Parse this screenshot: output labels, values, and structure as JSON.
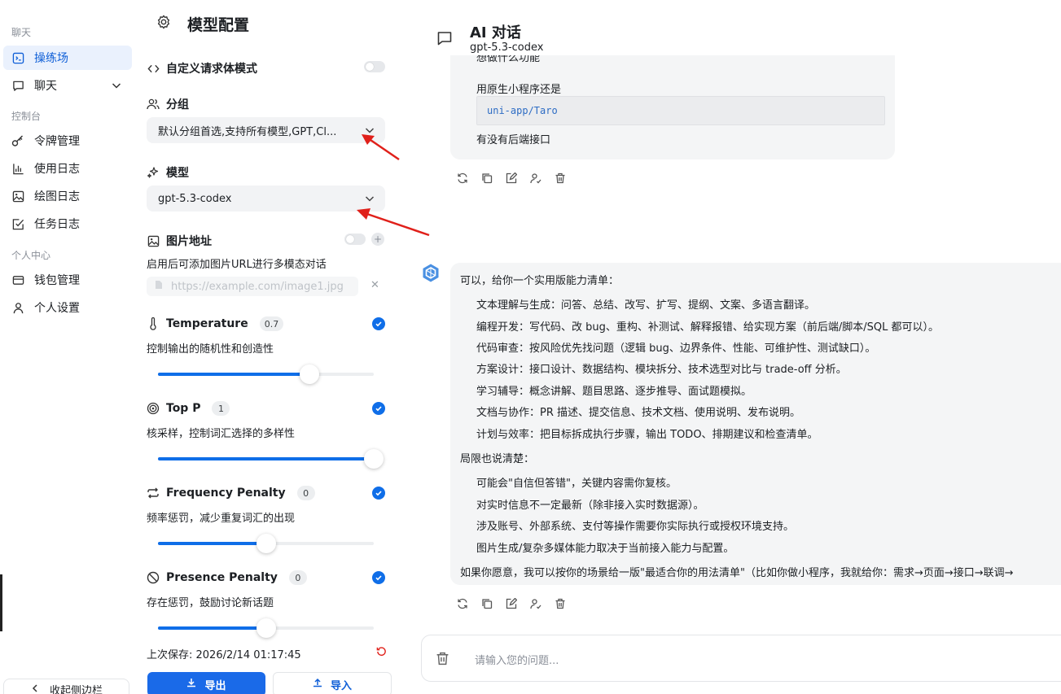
{
  "nav": {
    "section_chat": "聊天",
    "playground": "操练场",
    "chat": "聊天",
    "section_console": "控制台",
    "tokens": "令牌管理",
    "usage_logs": "使用日志",
    "draw_logs": "绘图日志",
    "task_logs": "任务日志",
    "section_personal": "个人中心",
    "wallet": "钱包管理",
    "settings": "个人设置",
    "collapse": "收起侧边栏"
  },
  "panel": {
    "title": "模型配置",
    "custom_body": "自定义请求体模式",
    "group_label": "分组",
    "group_value": "默认分组首选,支持所有模型,GPT,Cl...",
    "model_label": "模型",
    "model_value": "gpt-5.3-codex",
    "image_label": "图片地址",
    "image_desc": "启用后可添加图片URL进行多模态对话",
    "image_placeholder": "https://example.com/image1.jpg",
    "temperature": {
      "label": "Temperature",
      "value": "0.7",
      "desc": "控制输出的随机性和创造性",
      "fraction": 0.7
    },
    "top_p": {
      "label": "Top P",
      "value": "1",
      "desc": "核采样，控制词汇选择的多样性",
      "fraction": 1.0
    },
    "frequency": {
      "label": "Frequency Penalty",
      "value": "0",
      "desc": "频率惩罚，减少重复词汇的出现",
      "fraction": 0.5
    },
    "presence": {
      "label": "Presence Penalty",
      "value": "0",
      "desc": "存在惩罚，鼓励讨论新话题",
      "fraction": 0.5
    },
    "saved": "上次保存: 2026/2/14 01:17:45",
    "export": "导出",
    "import": "导入"
  },
  "chat": {
    "title": "AI 对话",
    "model": "gpt-5.3-codex",
    "msg1": {
      "cut": "想做什么功能",
      "line1": "用原生小程序还是",
      "code": "uni-app/Taro",
      "line2": "有没有后端接口"
    },
    "msg2": {
      "intro": "可以，给你一个实用版能力清单：",
      "items": [
        "文本理解与生成：问答、总结、改写、扩写、提纲、文案、多语言翻译。",
        "编程开发：写代码、改 bug、重构、补测试、解释报错、给实现方案（前后端/脚本/SQL 都可以）。",
        "代码审查：按风险优先找问题（逻辑 bug、边界条件、性能、可维护性、测试缺口）。",
        "方案设计：接口设计、数据结构、模块拆分、技术选型对比与 trade-off 分析。",
        "学习辅导：概念讲解、题目思路、逐步推导、面试题模拟。",
        "文档与协作：PR 描述、提交信息、技术文档、使用说明、发布说明。",
        "计划与效率：把目标拆成执行步骤，输出 TODO、排期建议和检查清单。"
      ],
      "limits_title": "局限也说清楚：",
      "limits": [
        "可能会\"自信但答错\"，关键内容需你复核。",
        "对实时信息不一定最新（除非接入实时数据源）。",
        "涉及账号、外部系统、支付等操作需要你实际执行或授权环境支持。",
        "图片生成/复杂多媒体能力取决于当前接入能力与配置。"
      ],
      "outro": "如果你愿意，我可以按你的场景给一版\"最适合你的用法清单\"（比如你做小程序，我就给你：需求→页面→接口→联调→"
    },
    "input_placeholder": "请输入您的问题..."
  },
  "colors": {
    "accent": "#1a6ae8",
    "annotation": "#e0201a"
  }
}
